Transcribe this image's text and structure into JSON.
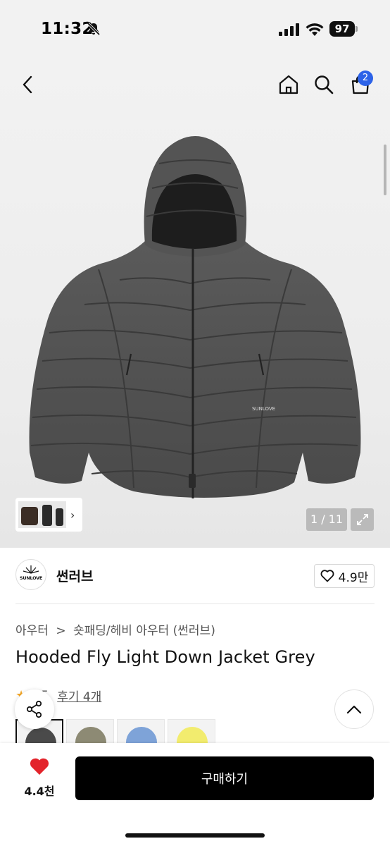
{
  "status_bar": {
    "time": "11:32",
    "battery": "97"
  },
  "nav": {
    "cart_count": "2",
    "icons": [
      "back-icon",
      "home-icon",
      "search-icon",
      "cart-icon"
    ]
  },
  "gallery": {
    "counter": "1 / 11",
    "thumb_arrow": "›"
  },
  "brand": {
    "name": "썬러브",
    "logo_text": "SUNLOVE",
    "likes": "4.9만"
  },
  "breadcrumb": {
    "category": "아우터",
    "separator": ">",
    "subcategory": "숏패딩/헤비 아우터 (썬러브)"
  },
  "product": {
    "title": "Hooded Fly Light Down Jacket Grey"
  },
  "rating": {
    "score": "4.5",
    "review_label": "후기 4개"
  },
  "colors": [
    {
      "name": "grey",
      "hex": "#4a4a4a"
    },
    {
      "name": "khaki",
      "hex": "#8d8a74"
    },
    {
      "name": "blue",
      "hex": "#7ea3d8"
    },
    {
      "name": "yellow",
      "hex": "#f2ec6e"
    }
  ],
  "bottom": {
    "fav_count": "4.4천",
    "buy_label": "구매하기"
  },
  "theme": {
    "accent": "#2d63e8",
    "heart": "#e3242b",
    "button": "#000000"
  }
}
